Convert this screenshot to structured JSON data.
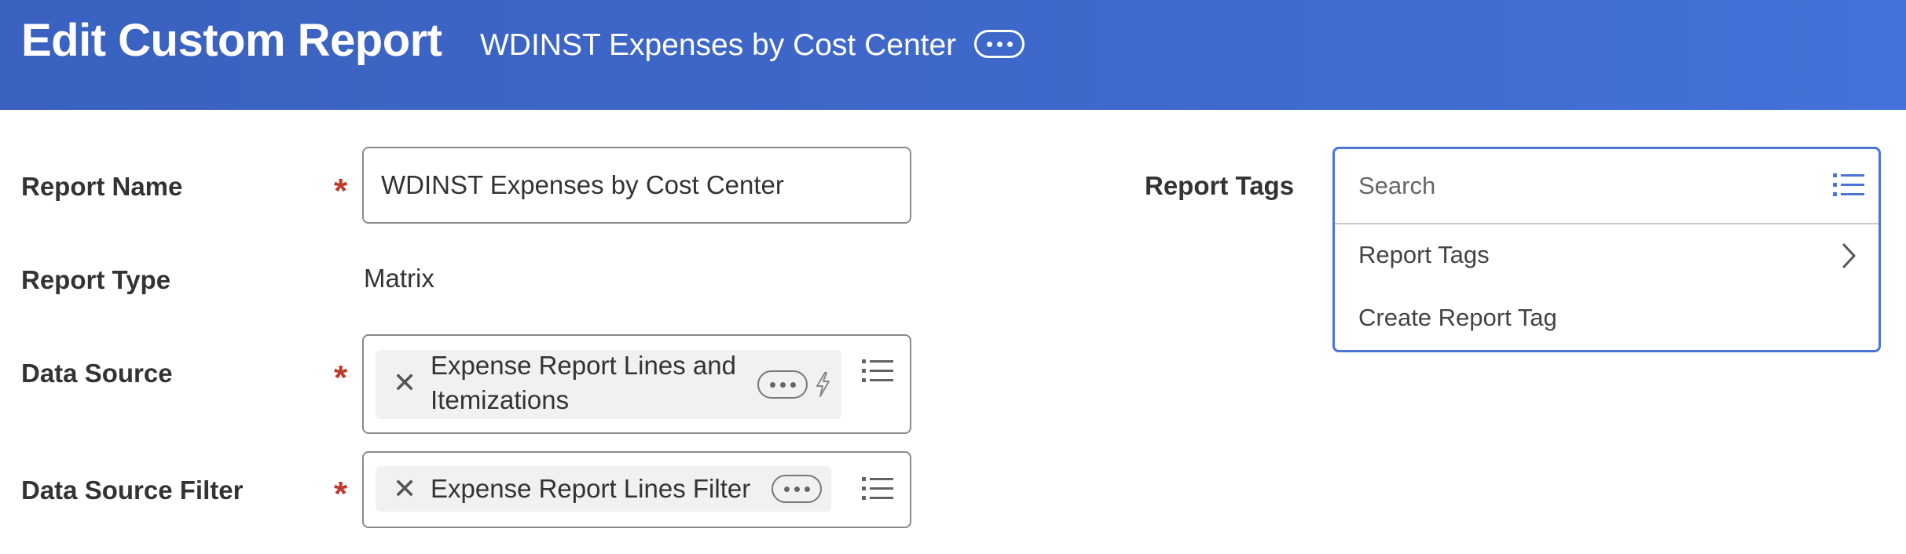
{
  "header": {
    "title": "Edit Custom Report",
    "report_name": "WDINST Expenses by Cost Center",
    "more_icon": "ellipsis-icon"
  },
  "fields": {
    "report_name": {
      "label": "Report Name",
      "required_mark": "*",
      "value": "WDINST Expenses by Cost Center"
    },
    "report_type": {
      "label": "Report Type",
      "value": "Matrix"
    },
    "data_source": {
      "label": "Data Source",
      "required_mark": "*",
      "selected_line1": "Expense Report Lines and",
      "selected_line2": "Itemizations",
      "icons": [
        "remove-x-icon",
        "ellipsis-icon",
        "lightning-bolt-icon",
        "list-prompt-icon"
      ]
    },
    "data_source_filter": {
      "label": "Data Source Filter",
      "required_mark": "*",
      "selected": "Expense Report Lines Filter",
      "icons": [
        "remove-x-icon",
        "ellipsis-icon",
        "list-prompt-icon"
      ]
    }
  },
  "report_tags": {
    "label": "Report Tags",
    "search_placeholder": "Search",
    "options": [
      {
        "label": "Report Tags",
        "has_submenu": true
      },
      {
        "label": "Create Report Tag",
        "has_submenu": false
      }
    ],
    "icons": [
      "list-prompt-icon",
      "chevron-right-icon"
    ]
  },
  "colors": {
    "header_bg": "#3f69cc",
    "required": "#c0392b",
    "focus_border": "#4a74d6",
    "list_icon": "#4a74d6"
  }
}
